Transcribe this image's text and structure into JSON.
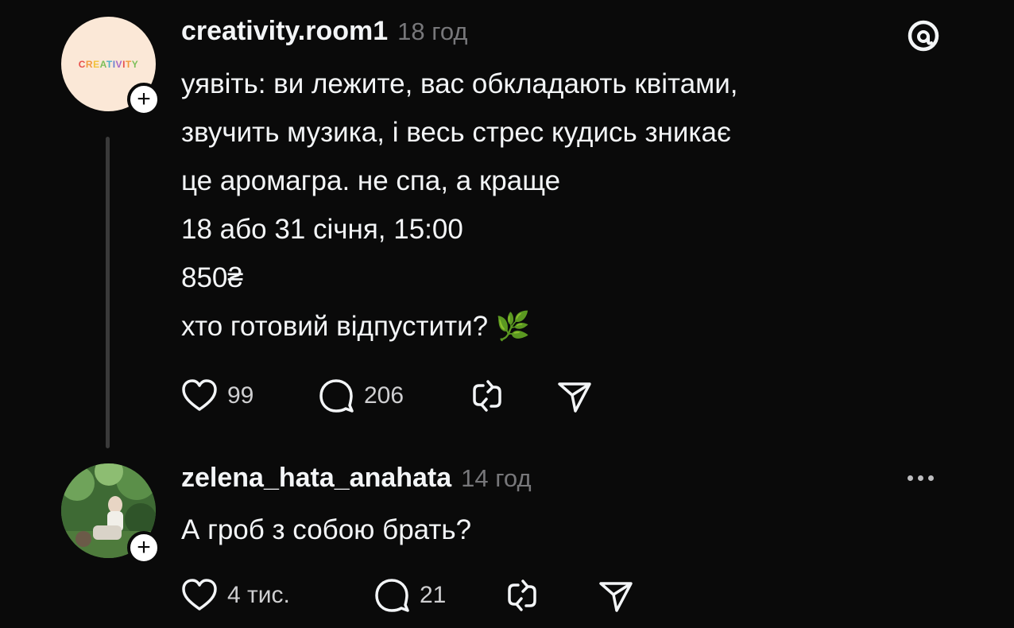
{
  "post": {
    "username": "creativity.room1",
    "time": "18 год",
    "avatar_text": "CREATIVITY",
    "lines": [
      "уявіть: ви лежите, вас обкладають квітами,",
      "звучить музика, і весь стрес кудись зникає",
      "це аромагра. не спа, а краще",
      "18 або 31 січня, 15:00",
      "850₴",
      "хто готовий відпустити? 🌿"
    ],
    "likes": "99",
    "replies": "206",
    "icons": {
      "like": "heart-icon",
      "reply": "comment-icon",
      "repost": "repost-icon",
      "share": "share-icon",
      "app": "threads-logo-icon",
      "follow": "plus-icon"
    }
  },
  "reply": {
    "username": "zelena_hata_anahata",
    "time": "14 год",
    "text": "А гроб з собою брать?",
    "likes": "4 тис.",
    "replies": "21",
    "icons": {
      "more": "more-icon"
    }
  },
  "colors": {
    "background": "#0a0a0a",
    "text": "#f3f5f7",
    "muted": "#77777a",
    "thread_line": "#3a3a3a"
  }
}
